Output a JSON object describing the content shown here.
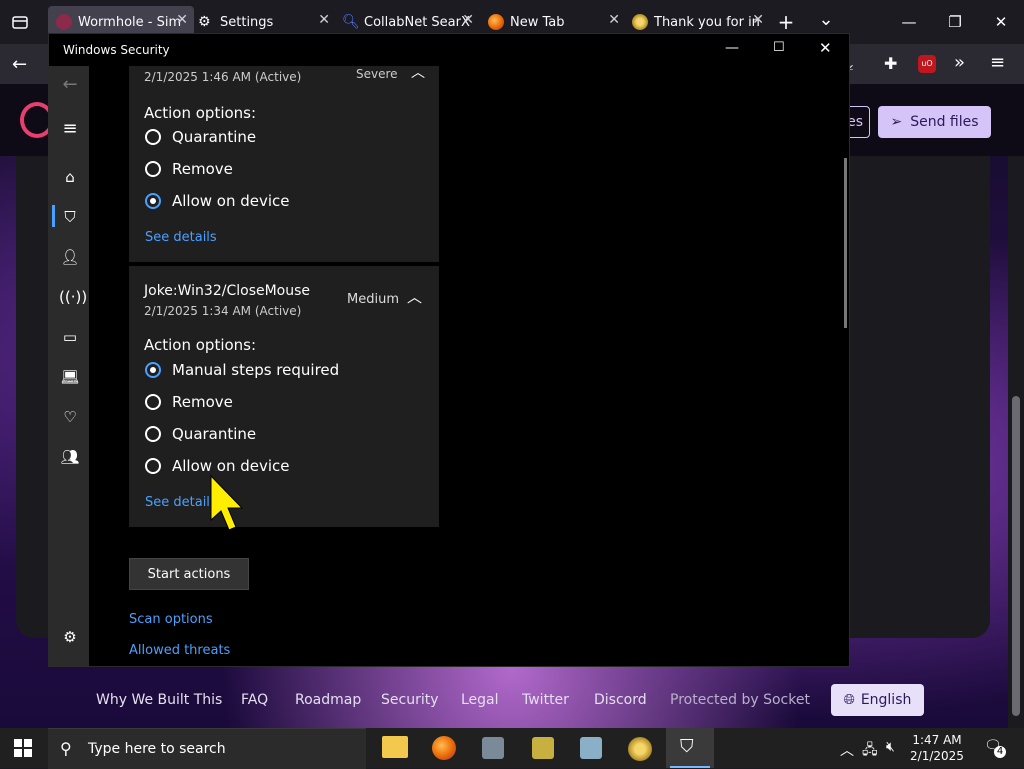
{
  "browser": {
    "tabs": [
      {
        "label": "Wormhole - Sim",
        "active": true
      },
      {
        "label": "Settings"
      },
      {
        "label": "CollabNet SearX"
      },
      {
        "label": "New Tab"
      },
      {
        "label": "Thank you for in"
      }
    ],
    "new_tab": "+",
    "tab_list": "⌄"
  },
  "site": {
    "send_files_label": "Send files",
    "partial_button_label": "es",
    "footer_links": [
      "Why We Built This",
      "FAQ",
      "Roadmap",
      "Security",
      "Legal",
      "Twitter",
      "Discord",
      "Protected by Socket"
    ],
    "language_label": "English"
  },
  "ws": {
    "title": "Windows Security",
    "threat1": {
      "date": "2/1/2025 1:46 AM (Active)",
      "severity": "Severe",
      "action_title": "Action options:",
      "options": [
        "Quarantine",
        "Remove",
        "Allow on device"
      ],
      "selected_index": 2,
      "see_details": "See details"
    },
    "threat2": {
      "name": "Joke:Win32/CloseMouse",
      "date": "2/1/2025 1:34 AM (Active)",
      "severity": "Medium",
      "action_title": "Action options:",
      "options": [
        "Manual steps required",
        "Remove",
        "Quarantine",
        "Allow on device"
      ],
      "selected_index": 0,
      "see_details": "See details"
    },
    "start_actions": "Start actions",
    "scan_options": "Scan options",
    "allowed_threats": "Allowed threats"
  },
  "taskbar": {
    "search_placeholder": "Type here to search",
    "time": "1:47 AM",
    "date": "2/1/2025",
    "notification_count": "4"
  },
  "colors": {
    "accent_link": "#4aa0ff",
    "brand_light": "#d4c4f7"
  }
}
